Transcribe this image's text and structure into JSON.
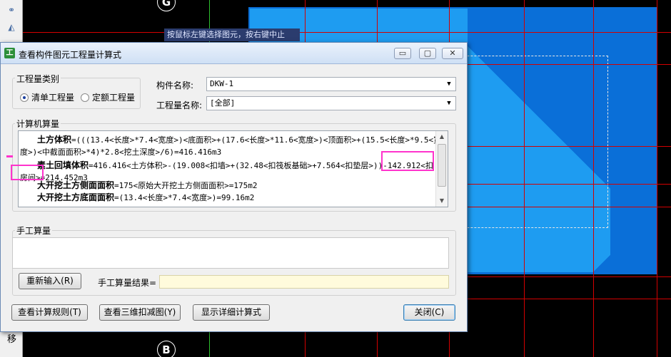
{
  "cad": {
    "axis_top": "G",
    "axis_bottom": "B",
    "tip_text": "按鼠标左键选择图元，按右键中止",
    "move_label": "移"
  },
  "dialog": {
    "title": "查看构件图元工程量计算式",
    "min_label": "▭",
    "max_label": "▢",
    "close_label": "✕",
    "quantity_type": {
      "label": "工程量类别",
      "options": [
        "清单工程量",
        "定额工程量"
      ],
      "selected": "清单工程量"
    },
    "component_name": {
      "label": "构件名称:",
      "value": "DKW-1"
    },
    "quantity_name": {
      "label": "工程量名称:",
      "value": "[全部]"
    },
    "computer_calc": {
      "label": "计算机算量",
      "lines": [
        {
          "name": "土方体积",
          "formula_a": "=(((13.4<长度>*7.4<宽度>)<底面积>+(17.6<长度>*11.6<宽度>)<顶面积>+(15.5<长度>*9.5<宽",
          "formula_b": "度>)<中截面面积>*4)*2.8<挖土深度>/6)=416.416m3"
        },
        {
          "name": "素土回填体积",
          "formula_a": "=416.416<土方体积>-(19.008<扣墙>+(32.48<扣筏板基础>+7.564<扣垫层>))-142.912<扣",
          "formula_b": "房间>=214.452m3"
        },
        {
          "name": "大开挖土方侧面面积",
          "formula_a": "=175<原始大开挖土方侧面面积>=175m2"
        },
        {
          "name": "大开挖土方底面面积",
          "formula_a": "=(13.4<长度>*7.4<宽度>)=99.16m2"
        }
      ]
    },
    "manual_calc": {
      "label": "手工算量",
      "input_value": "",
      "reenter_button": "重新输入(R)",
      "result_label": "手工算量结果=",
      "result_value": ""
    },
    "buttons": {
      "view_rules": "查看计算规则(T)",
      "view_3d": "查看三维扣减图(Y)",
      "show_detail": "显示详细计算式",
      "close": "关闭(C)"
    }
  }
}
